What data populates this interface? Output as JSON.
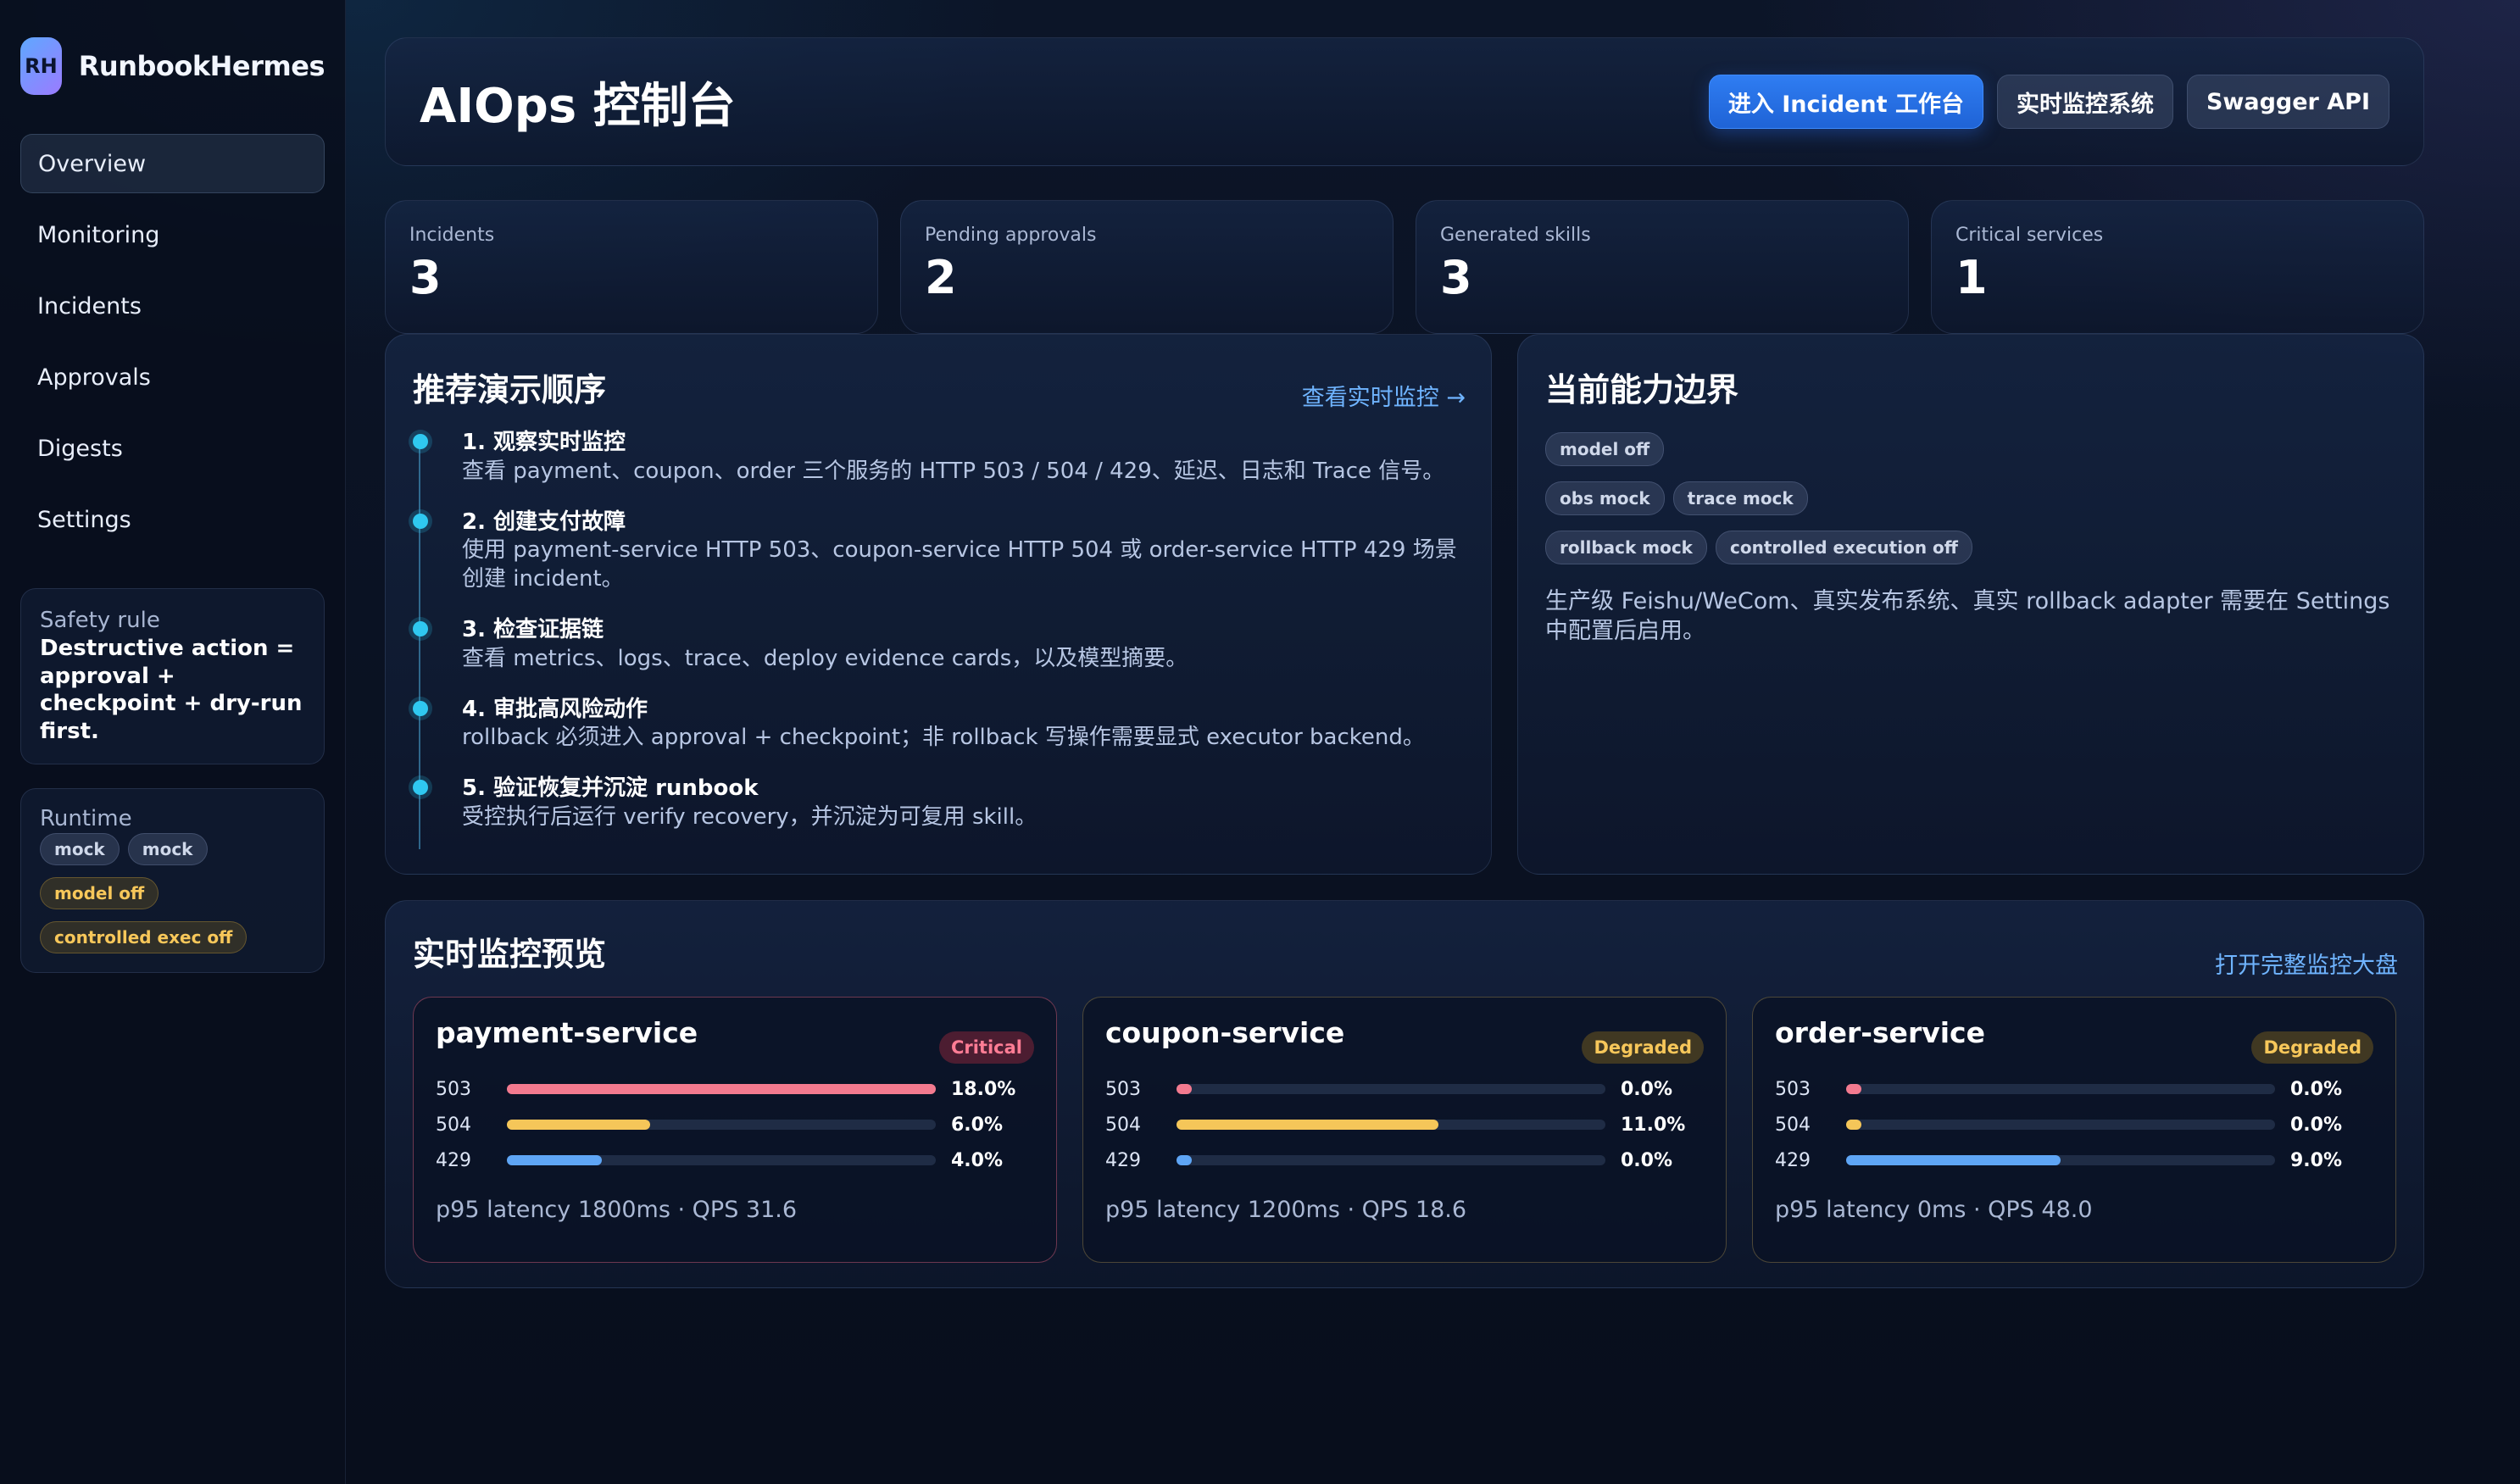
{
  "brand": {
    "logo": "RH",
    "name": "RunbookHermes"
  },
  "nav": [
    {
      "label": "Overview",
      "active": true
    },
    {
      "label": "Monitoring"
    },
    {
      "label": "Incidents"
    },
    {
      "label": "Approvals"
    },
    {
      "label": "Digests"
    },
    {
      "label": "Settings"
    }
  ],
  "safety": {
    "label": "Safety rule",
    "text": "Destructive action = approval + checkpoint + dry-run first."
  },
  "runtime": {
    "label": "Runtime",
    "chips": [
      "mock",
      "mock"
    ],
    "warn_chips": [
      "model off",
      "controlled exec off"
    ]
  },
  "header": {
    "title": "AIOps 控制台",
    "buttons": {
      "primary": "进入 Incident 工作台",
      "monitor": "实时监控系统",
      "swagger": "Swagger API"
    }
  },
  "stats": [
    {
      "label": "Incidents",
      "value": "3"
    },
    {
      "label": "Pending approvals",
      "value": "2"
    },
    {
      "label": "Generated skills",
      "value": "3"
    },
    {
      "label": "Critical services",
      "value": "1"
    }
  ],
  "demo": {
    "title": "推荐演示顺序",
    "link": "查看实时监控 →",
    "steps": [
      {
        "title": "1. 观察实时监控",
        "desc": "查看 payment、coupon、order 三个服务的 HTTP 503 / 504 / 429、延迟、日志和 Trace 信号。"
      },
      {
        "title": "2. 创建支付故障",
        "desc": "使用 payment-service HTTP 503、coupon-service HTTP 504 或 order-service HTTP 429 场景创建 incident。"
      },
      {
        "title": "3. 检查证据链",
        "desc": "查看 metrics、logs、trace、deploy evidence cards，以及模型摘要。"
      },
      {
        "title": "4. 审批高风险动作",
        "desc": "rollback 必须进入 approval + checkpoint；非 rollback 写操作需要显式 executor backend。"
      },
      {
        "title": "5. 验证恢复并沉淀 runbook",
        "desc": "受控执行后运行 verify recovery，并沉淀为可复用 skill。"
      }
    ]
  },
  "bounds": {
    "title": "当前能力边界",
    "chip_rows": [
      [
        "model off"
      ],
      [
        "obs mock",
        "trace mock"
      ],
      [
        "rollback mock",
        "controlled execution off"
      ]
    ],
    "note": "生产级 Feishu/WeCom、真实发布系统、真实 rollback adapter 需要在 Settings 中配置后启用。"
  },
  "monitor": {
    "title": "实时监控预览",
    "link": "打开完整监控大盘",
    "colors": {
      "503": "#f37a8f",
      "504": "#f5c659",
      "429": "#5ea5f5"
    },
    "services": [
      {
        "name": "payment-service",
        "status": "Critical",
        "bars": [
          {
            "code": "503",
            "pct": 18.0,
            "label": "18.0%"
          },
          {
            "code": "504",
            "pct": 6.0,
            "label": "6.0%"
          },
          {
            "code": "429",
            "pct": 4.0,
            "label": "4.0%"
          }
        ],
        "footer": "p95 latency 1800ms · QPS 31.6"
      },
      {
        "name": "coupon-service",
        "status": "Degraded",
        "bars": [
          {
            "code": "503",
            "pct": 0.0,
            "label": "0.0%"
          },
          {
            "code": "504",
            "pct": 11.0,
            "label": "11.0%"
          },
          {
            "code": "429",
            "pct": 0.0,
            "label": "0.0%"
          }
        ],
        "footer": "p95 latency 1200ms · QPS 18.6"
      },
      {
        "name": "order-service",
        "status": "Degraded",
        "bars": [
          {
            "code": "503",
            "pct": 0.0,
            "label": "0.0%"
          },
          {
            "code": "504",
            "pct": 0.0,
            "label": "0.0%"
          },
          {
            "code": "429",
            "pct": 9.0,
            "label": "9.0%"
          }
        ],
        "footer": "p95 latency 0ms · QPS 48.0"
      }
    ]
  }
}
